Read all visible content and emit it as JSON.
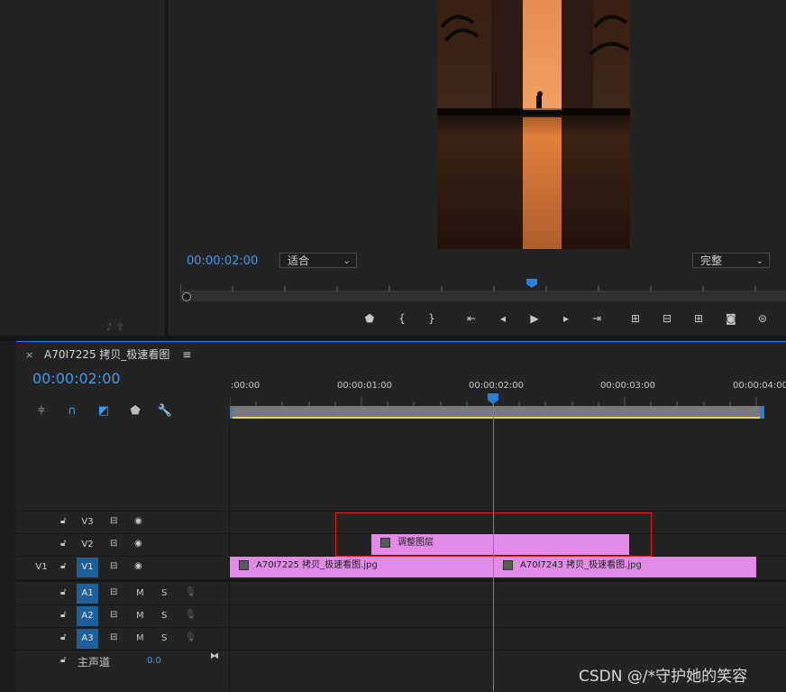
{
  "monitor": {
    "timecode": "00:00:02:00",
    "zoom": "适合",
    "resolution": "完整"
  },
  "timeline": {
    "tab_close": "×",
    "sequence_name": "A70I7225 拷贝_极速看图",
    "menu_icon": "≡",
    "timecode": "00:00:02:00",
    "ruler_labels": [
      ":00:00",
      "00:00:01:00",
      "00:00:02:00",
      "00:00:03:00",
      "00:00:04:00"
    ],
    "tracks": {
      "v3": {
        "label": "V3"
      },
      "v2": {
        "label": "V2"
      },
      "v1": {
        "label": "V1",
        "source": "V1"
      },
      "a1": {
        "label": "A1"
      },
      "a2": {
        "label": "A2"
      },
      "a3": {
        "label": "A3"
      },
      "master": {
        "label": "主声道",
        "value": "0.0"
      }
    },
    "mute": "M",
    "solo": "S",
    "clips": {
      "adjustment": "调整图层",
      "clip1": "A70I7225 拷贝_极速看图.jpg",
      "clip2": "A70I7243 拷贝_极速看图.jpg"
    },
    "clip_color": "#e18ae6",
    "accent": "#3d9bf0"
  },
  "watermark": "CSDN @/*守护她的笑容"
}
